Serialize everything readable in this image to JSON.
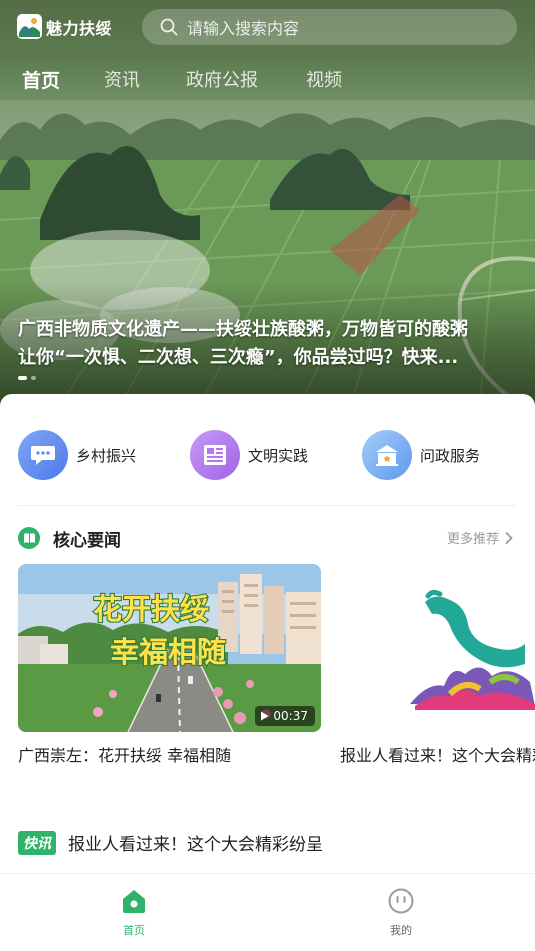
{
  "app": {
    "name": "魅力扶绥",
    "logo_icon": "app-logo-icon"
  },
  "search": {
    "placeholder": "请输入搜索内容",
    "icon": "search-icon"
  },
  "tabs": [
    {
      "label": "首页",
      "active": true
    },
    {
      "label": "资讯",
      "active": false
    },
    {
      "label": "政府公报",
      "active": false
    },
    {
      "label": "视频",
      "active": false
    }
  ],
  "banner": {
    "caption_line1": "广西非物质文化遗产——扶绥壮族酸粥，万物皆可的酸粥",
    "caption_line2": "让你“一次惧、二次想、三次瘾”，你品尝过吗？快来...",
    "slide_index": 1,
    "slide_count": 2
  },
  "shortcuts": [
    {
      "label": "乡村振兴",
      "icon": "chat-bubble-icon",
      "color": "#5b86f0"
    },
    {
      "label": "文明实践",
      "icon": "newspaper-icon",
      "color": "#b279ee"
    },
    {
      "label": "问政服务",
      "icon": "government-building-icon",
      "color": "#6fa7f2"
    }
  ],
  "core_news": {
    "title": "核心要闻",
    "more_label": "更多推荐",
    "items": [
      {
        "title": "广西崇左：花开扶绥 幸福相随",
        "thumb_text_1": "花开扶绥",
        "thumb_text_2": "幸福相随",
        "duration": "00:37"
      },
      {
        "title": "报业人看过来！这个大会精彩纷呈"
      }
    ]
  },
  "flash": {
    "badge": "快讯",
    "text": "报业人看过来！这个大会精彩纷呈"
  },
  "bottom_nav": [
    {
      "label": "首页",
      "icon": "home-icon",
      "active": true
    },
    {
      "label": "我的",
      "icon": "profile-face-icon",
      "active": false
    }
  ],
  "colors": {
    "accent": "#2fb36a",
    "header_green": "#546d46"
  }
}
